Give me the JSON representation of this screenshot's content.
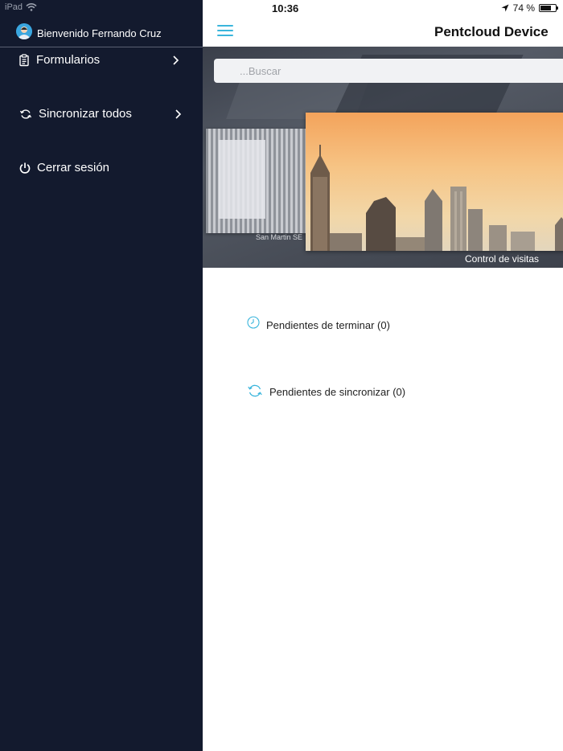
{
  "status_bar": {
    "device": "iPad",
    "time": "10:36",
    "battery": "74 %",
    "battery_level": 0.74
  },
  "sidebar": {
    "welcome": "Bienvenido Fernando Cruz",
    "items": [
      {
        "label": "Formularios",
        "icon": "clipboard-icon",
        "has_chevron": true
      },
      {
        "label": "Sincronizar todos",
        "icon": "sync-icon",
        "has_chevron": true
      },
      {
        "label": "Cerrar sesión",
        "icon": "power-icon",
        "has_chevron": false
      }
    ]
  },
  "header": {
    "title": "Pentcloud Device"
  },
  "search": {
    "placeholder": "...Buscar"
  },
  "forms": [
    {
      "caption": "San Martin SE"
    },
    {
      "caption": "Control de visitas"
    }
  ],
  "pending": {
    "to_finish": "Pendientes de terminar (0)",
    "to_sync": "Pendientes de sincronizar (0)"
  },
  "colors": {
    "sidebar_bg": "#131a2e",
    "accent": "#3ab5dc"
  }
}
